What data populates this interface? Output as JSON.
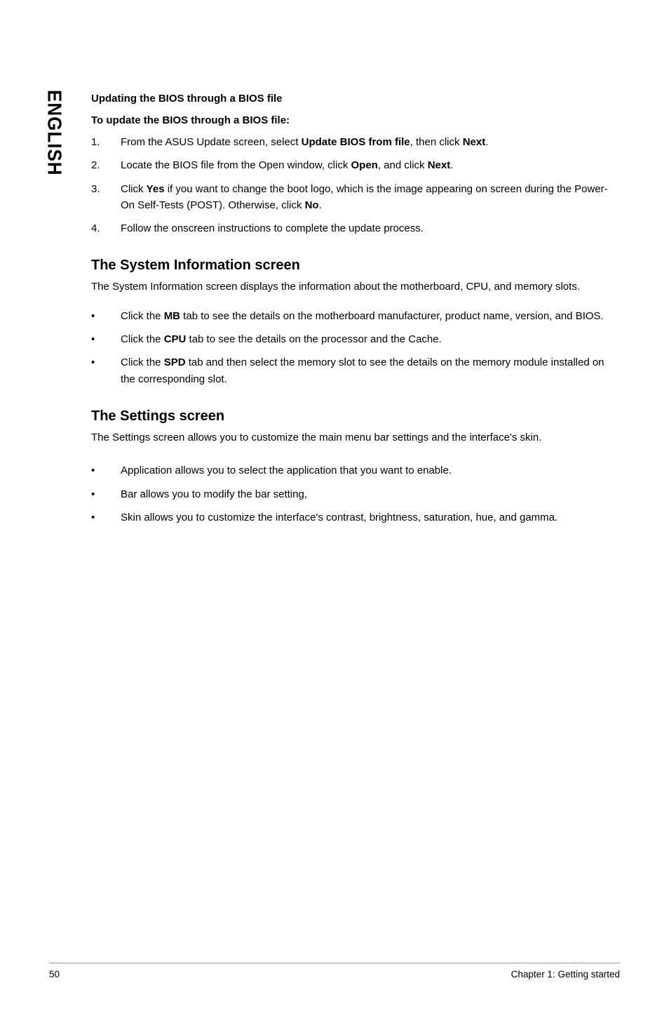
{
  "side_label": "ENGLISH",
  "sec_update": {
    "h1": "Updating the BIOS through a BIOS file",
    "h2": "To update the BIOS through a BIOS file:",
    "items": [
      {
        "num": "1.",
        "pre": "From the ASUS Update screen, select ",
        "b1": "Update BIOS from file",
        "mid": ", then click ",
        "b2": "Next",
        "post": "."
      },
      {
        "num": "2.",
        "pre": "Locate the BIOS file from the Open window, click ",
        "b1": "Open",
        "mid": ", and click ",
        "b2": "Next",
        "post": "."
      },
      {
        "num": "3.",
        "pre": "Click ",
        "b1": "Yes",
        "mid": " if you want to change the boot logo, which is the image appearing on screen during the Power-On Self-Tests (POST). Otherwise, click ",
        "b2": "No",
        "post": "."
      },
      {
        "num": "4.",
        "pre": "Follow the onscreen instructions to complete the update process.",
        "b1": "",
        "mid": "",
        "b2": "",
        "post": ""
      }
    ]
  },
  "sec_sysinfo": {
    "title": "The System Information screen",
    "intro": "The System Information screen displays the information about the motherboard, CPU, and memory slots.",
    "items": [
      {
        "pre": "Click the ",
        "b": "MB",
        "post": " tab to see the details on the motherboard manufacturer, product name, version, and BIOS."
      },
      {
        "pre": "Click the ",
        "b": "CPU",
        "post": " tab to see the details on the processor and the Cache."
      },
      {
        "pre": "Click the ",
        "b": "SPD",
        "post": " tab and then select the memory slot to see the details on the memory module installed on the corresponding slot."
      }
    ]
  },
  "sec_settings": {
    "title": "The Settings screen",
    "intro": "The Settings screen allows you to customize the main menu bar settings and the interface's skin.",
    "items": [
      {
        "text": "Application allows you to select the application that you want to enable."
      },
      {
        "text": "Bar allows you to modify the bar setting,"
      },
      {
        "text": "Skin allows you to customize the interface's contrast, brightness, saturation, hue, and gamma."
      }
    ]
  },
  "footer": {
    "page": "50",
    "chapter": "Chapter 1: Getting started"
  }
}
